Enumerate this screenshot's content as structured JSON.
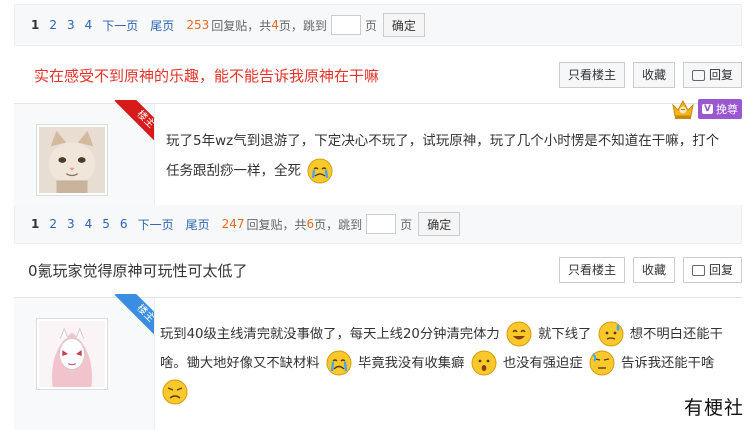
{
  "colors": {
    "link": "#2d64b3",
    "count": "#e06a1f",
    "title_red": "#e1352b",
    "ribbon_red": "#d71b1b",
    "ribbon_blue": "#3a8de0",
    "vip_purple": "#9a58d0"
  },
  "thread1": {
    "pager": {
      "pages": [
        "1",
        "2",
        "3",
        "4"
      ],
      "next": "下一页",
      "last": "尾页",
      "reply_count": "253",
      "reply_label": "回复贴，共",
      "page_total": "4",
      "page_unit": "页，跳到",
      "page_suffix": "页",
      "confirm": "确定"
    },
    "title": "实在感受不到原神的乐趣，能不能告诉我原神在干嘛",
    "actions": {
      "only_op": "只看楼主",
      "favorite": "收藏",
      "reply": "回复"
    },
    "ribbon": "楼主",
    "badge": {
      "icon": "crown-icon",
      "vip_v": "V",
      "vip_text": "挽尊"
    },
    "post": {
      "text": "玩了5年wz气到退游了，下定决心不玩了，试玩原神，玩了几个小时愣是不知道在干嘛，打个任务跟刮痧一样，全死",
      "emoji": "crying-emoji"
    }
  },
  "thread2": {
    "pager": {
      "pages": [
        "1",
        "2",
        "3",
        "4",
        "5",
        "6"
      ],
      "next": "下一页",
      "last": "尾页",
      "reply_count": "247",
      "reply_label": "回复贴，共",
      "page_total": "6",
      "page_unit": "页，跳到",
      "page_suffix": "页",
      "confirm": "确定"
    },
    "title": "0氪玩家觉得原神可玩性可太低了",
    "actions": {
      "only_op": "只看楼主",
      "favorite": "收藏",
      "reply": "回复"
    },
    "ribbon": "楼主",
    "post": {
      "seg1": "玩到40级主线清完就没事做了，每天上线20分钟清完体力",
      "seg2": "就下线了",
      "seg3": "想不明白还能干啥。锄大地好像又不缺材料",
      "seg4": "毕竟我没有收集癖",
      "seg5": "也没有强迫症",
      "seg6": "告诉我还能干啥",
      "emojis": [
        "smile-emoji",
        "sweat-emoji",
        "crying-emoji",
        "surprised-emoji",
        "sweat-emoji",
        "frown-emoji"
      ]
    }
  },
  "watermark": "有梗社"
}
